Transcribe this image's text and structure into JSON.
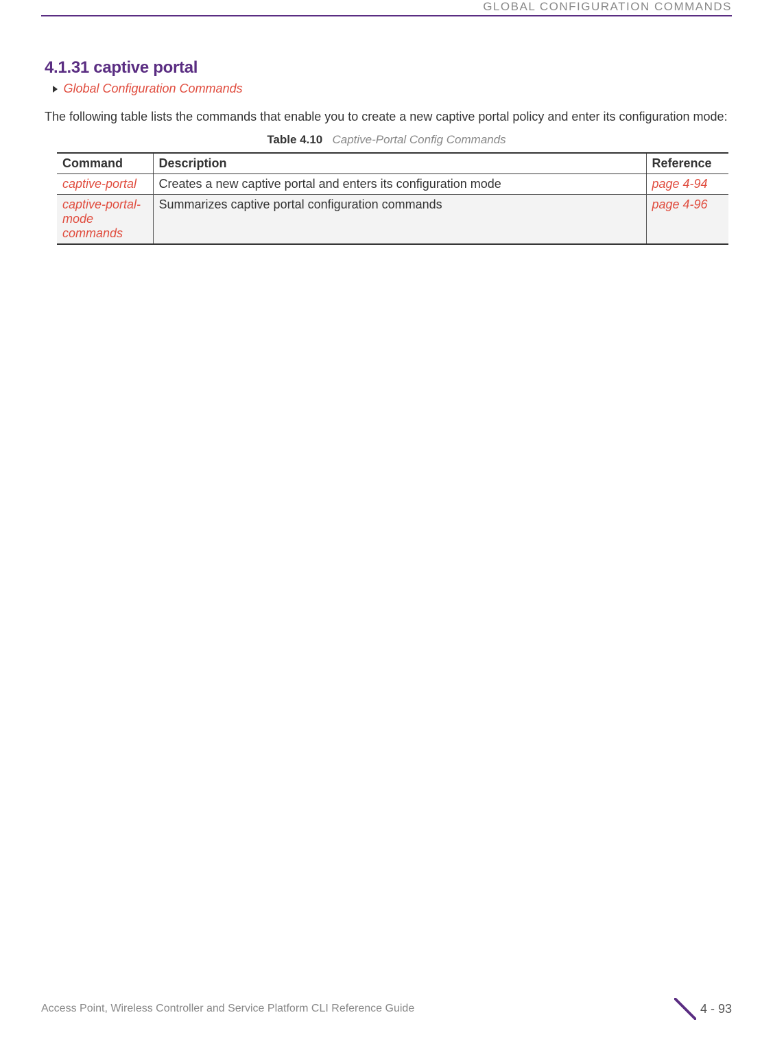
{
  "header": {
    "running_head": "GLOBAL CONFIGURATION COMMANDS"
  },
  "section": {
    "number_title": "4.1.31 captive portal",
    "breadcrumb": "Global Configuration Commands",
    "intro": "The following table lists the commands that enable you to create a new captive portal policy and enter its configuration mode:"
  },
  "table": {
    "caption_label": "Table 4.10",
    "caption_title": "Captive-Portal Config Commands",
    "headers": {
      "command": "Command",
      "description": "Description",
      "reference": "Reference"
    },
    "rows": [
      {
        "command": "captive-portal",
        "description": "Creates a new captive portal and enters its configuration mode",
        "reference": "page 4-94"
      },
      {
        "command": "captive-portal-mode commands",
        "description": "Summarizes captive portal configuration commands",
        "reference": "page 4-96"
      }
    ]
  },
  "footer": {
    "guide_title": "Access Point, Wireless Controller and Service Platform CLI Reference Guide",
    "page_number": "4 - 93"
  }
}
